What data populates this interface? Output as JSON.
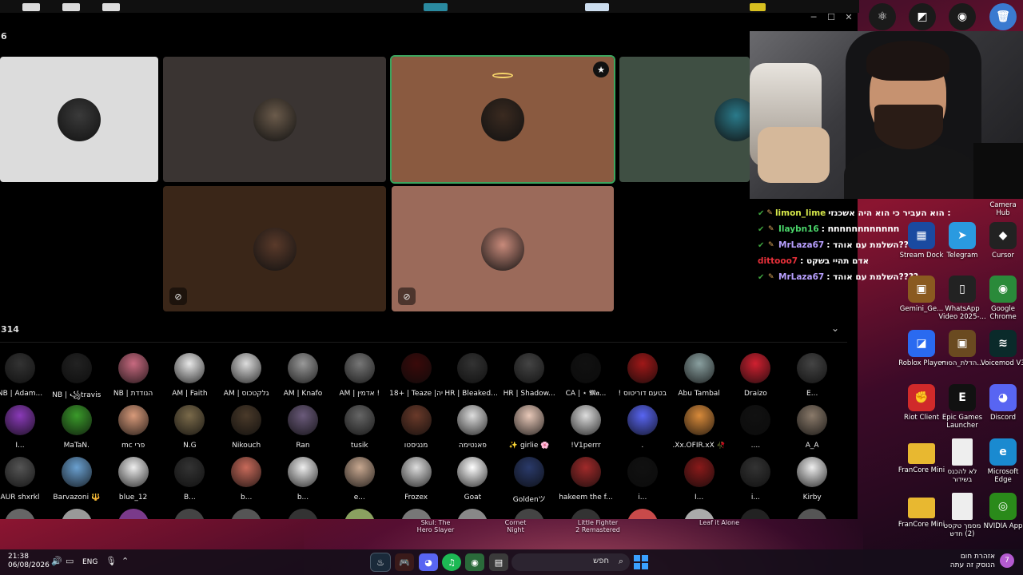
{
  "discord": {
    "participant_count": "6",
    "audience_count": "314",
    "window_controls": [
      "─",
      "☐",
      "✕"
    ],
    "stage_tiles": [
      {
        "bg": "#dcdcdc",
        "avatar": "#3a3a3a"
      },
      {
        "bg": "#3a3432",
        "avatar": "#6b5b4b"
      },
      {
        "bg": "#8a5a40",
        "avatar": "#3a2a20",
        "speaking": true,
        "halo": true,
        "badge_icon": "star-icon"
      },
      {
        "bg": "#3f4f43",
        "avatar": "#2a7a8a"
      },
      {
        "bg": "#3a2618",
        "avatar": "#5a3a2a",
        "muted": true
      },
      {
        "bg": "#9b6a5a",
        "avatar": "#c88a7a",
        "muted": true
      }
    ],
    "audience": [
      {
        "name": "NB | Adam...",
        "color": "#333"
      },
      {
        "name": "NB | ꧁travis",
        "color": "#222"
      },
      {
        "name": "NB | הנודדת",
        "color": "#c86a80"
      },
      {
        "name": "AM | Faith",
        "color": "#e8e8e8"
      },
      {
        "name": "AM | גלקטכוס",
        "color": "#ddd"
      },
      {
        "name": "AM | Knafo",
        "color": "#999"
      },
      {
        "name": "AM | אדמין !",
        "color": "#777"
      },
      {
        "name": "18+ | Teaze |יה",
        "color": "#3a0a0a"
      },
      {
        "name": "HR | BleakedA...",
        "color": "#333"
      },
      {
        "name": "HR | Shadow...",
        "color": "#444"
      },
      {
        "name": "CA | ⋆ 𝕸𝖆...",
        "color": "#111"
      },
      {
        "name": "! בטעם דוריטוס",
        "color": "#a01818"
      },
      {
        "name": "Abu Tambal",
        "color": "#8aa0a0"
      },
      {
        "name": "Draizo",
        "color": "#d02030"
      },
      {
        "name": "E...",
        "color": "#444"
      },
      {
        "name": "I...",
        "color": "#8a3ab8"
      },
      {
        "name": "MaTaN.",
        "color": "#3a9a2a"
      },
      {
        "name": "mc פרי",
        "color": "#d89a7a"
      },
      {
        "name": "N.G",
        "color": "#7a6a4a"
      },
      {
        "name": "Nikouch",
        "color": "#4a3a2a"
      },
      {
        "name": "Ran",
        "color": "#6a5a7a"
      },
      {
        "name": "tusik",
        "color": "#666"
      },
      {
        "name": "מנגיסטו",
        "color": "#6a3a2a"
      },
      {
        "name": "פאנטימה",
        "color": "#ddd"
      },
      {
        "name": "✨ girlie 🌸",
        "color": "#e8c8b8"
      },
      {
        "name": "!V1perrr",
        "color": "#ddd"
      },
      {
        "name": ".",
        "color": "#5865f2"
      },
      {
        "name": ".Xx.OFIR.xX 🥀",
        "color": "#d88a3a"
      },
      {
        "name": "....",
        "color": "#111"
      },
      {
        "name": "A_A",
        "color": "#8a7a6a"
      },
      {
        "name": "AUR shxrkl",
        "color": "#555"
      },
      {
        "name": "Barvazoni 🔱",
        "color": "#6aa0d0"
      },
      {
        "name": "blue_12",
        "color": "#eee"
      },
      {
        "name": "B...",
        "color": "#333"
      },
      {
        "name": "b...",
        "color": "#c86a5a"
      },
      {
        "name": "b...",
        "color": "#eee"
      },
      {
        "name": "e...",
        "color": "#c8a890"
      },
      {
        "name": "Frozex",
        "color": "#ddd"
      },
      {
        "name": "Goat",
        "color": "#fff"
      },
      {
        "name": "Goldenツ",
        "color": "#2a3a6a"
      },
      {
        "name": "hakeem the f...",
        "color": "#a02a2a"
      },
      {
        "name": "i...",
        "color": "#111"
      },
      {
        "name": "I...",
        "color": "#8a1a1a"
      },
      {
        "name": "i...",
        "color": "#333"
      },
      {
        "name": "Kirby",
        "color": "#eee"
      }
    ]
  },
  "chat": [
    {
      "user": "limon_lime",
      "user_color": "#d6e84a",
      "msg": "הוא העביר כי הוא היה אשכנזי :",
      "badges": [
        "check",
        "pen"
      ]
    },
    {
      "user": "Ilaybn16",
      "user_color": "#4ad66a",
      "msg": ": nnnnnnnnnnnn",
      "badges": [
        "check",
        "pen"
      ]
    },
    {
      "user": "MrLaza67",
      "user_color": "#b8a0ff",
      "msg": ": השלמת עם אוהד????",
      "badges": [
        "check",
        "pen"
      ]
    },
    {
      "user": "dittooo7",
      "user_color": "#e8303a",
      "msg": ": אדם תהיי בשקט",
      "badges": []
    },
    {
      "user": "MrLaza67",
      "user_color": "#b8a0ff",
      "msg": ": השלמת עם אוהד????",
      "badges": [
        "check",
        "pen"
      ]
    }
  ],
  "desktop_icons": [
    {
      "label": "Stream Dock",
      "icon": "grid-icon",
      "color": "#1a4aa0",
      "glyph": "▦"
    },
    {
      "label": "Telegram",
      "icon": "telegram-icon",
      "color": "#2a9ae0",
      "glyph": "➤"
    },
    {
      "label": "Cursor",
      "icon": "cursor-icon",
      "color": "#222",
      "glyph": "◆"
    },
    {
      "label": "Gemini_Ge...",
      "icon": "image-icon",
      "color": "#8a5a20",
      "glyph": "▣"
    },
    {
      "label": "WhatsApp Video 2025-...",
      "icon": "video-icon",
      "color": "#222",
      "glyph": "▯"
    },
    {
      "label": "Google Chrome",
      "icon": "chrome-icon",
      "color": "#2a8a3a",
      "glyph": "◉"
    },
    {
      "label": "Roblox Player",
      "icon": "roblox-icon",
      "color": "#2a6af0",
      "glyph": "◪"
    },
    {
      "label": "הדלת_הסודי...",
      "icon": "image-icon",
      "color": "#6a4a20",
      "glyph": "▣"
    },
    {
      "label": "Voicemod V3",
      "icon": "voicemod-icon",
      "color": "#0a2a2a",
      "glyph": "≋"
    },
    {
      "label": "Riot Client",
      "icon": "riot-icon",
      "color": "#d02a2a",
      "glyph": "✊"
    },
    {
      "label": "Epic Games Launcher",
      "icon": "epic-icon",
      "color": "#111",
      "glyph": "E"
    },
    {
      "label": "Discord",
      "icon": "discord-icon",
      "color": "#5865f2",
      "glyph": "◕"
    },
    {
      "label": "FranCore Mini",
      "icon": "folder-icon",
      "color": "#e8b830",
      "glyph": ""
    },
    {
      "label": "לא להכנס בשידור",
      "icon": "file-icon",
      "color": "#eee",
      "glyph": ""
    },
    {
      "label": "Microsoft Edge",
      "icon": "edge-icon",
      "color": "#1a8ad0",
      "glyph": "e"
    },
    {
      "label": "FranCore Mini",
      "icon": "folder-icon",
      "color": "#e8b830",
      "glyph": ""
    },
    {
      "label": "מסמך טקסט (2) חדש",
      "icon": "file-icon",
      "color": "#eee",
      "glyph": ""
    },
    {
      "label": "NVIDIA App",
      "icon": "nvidia-icon",
      "color": "#2a8a1a",
      "glyph": "◎"
    }
  ],
  "desktop_top_icons": [
    {
      "label": "",
      "icon": "electron-icon",
      "glyph": "⚛"
    },
    {
      "label": "",
      "icon": "roblox-studio-icon",
      "glyph": "◩"
    },
    {
      "label": "",
      "icon": "obs-icon",
      "glyph": "◉"
    },
    {
      "label": "",
      "icon": "recycle-bin-icon",
      "glyph": "🗑"
    }
  ],
  "desktop_partial_labels": [
    "Camera Hub"
  ],
  "game_labels": [
    {
      "text": "Skul: The Hero Slayer"
    },
    {
      "text": "Cornet Night"
    },
    {
      "text": "Little Fighter 2 Remastered"
    },
    {
      "text": "Leaf it Alone"
    }
  ],
  "taskbar": {
    "time": "21:38",
    "date": "06/08/2026",
    "lang": "ENG",
    "search_placeholder": "חפש",
    "weather_line1": "אזהרת חום",
    "weather_line2": "הנוסק זה עתה",
    "weather_badge": "7"
  }
}
